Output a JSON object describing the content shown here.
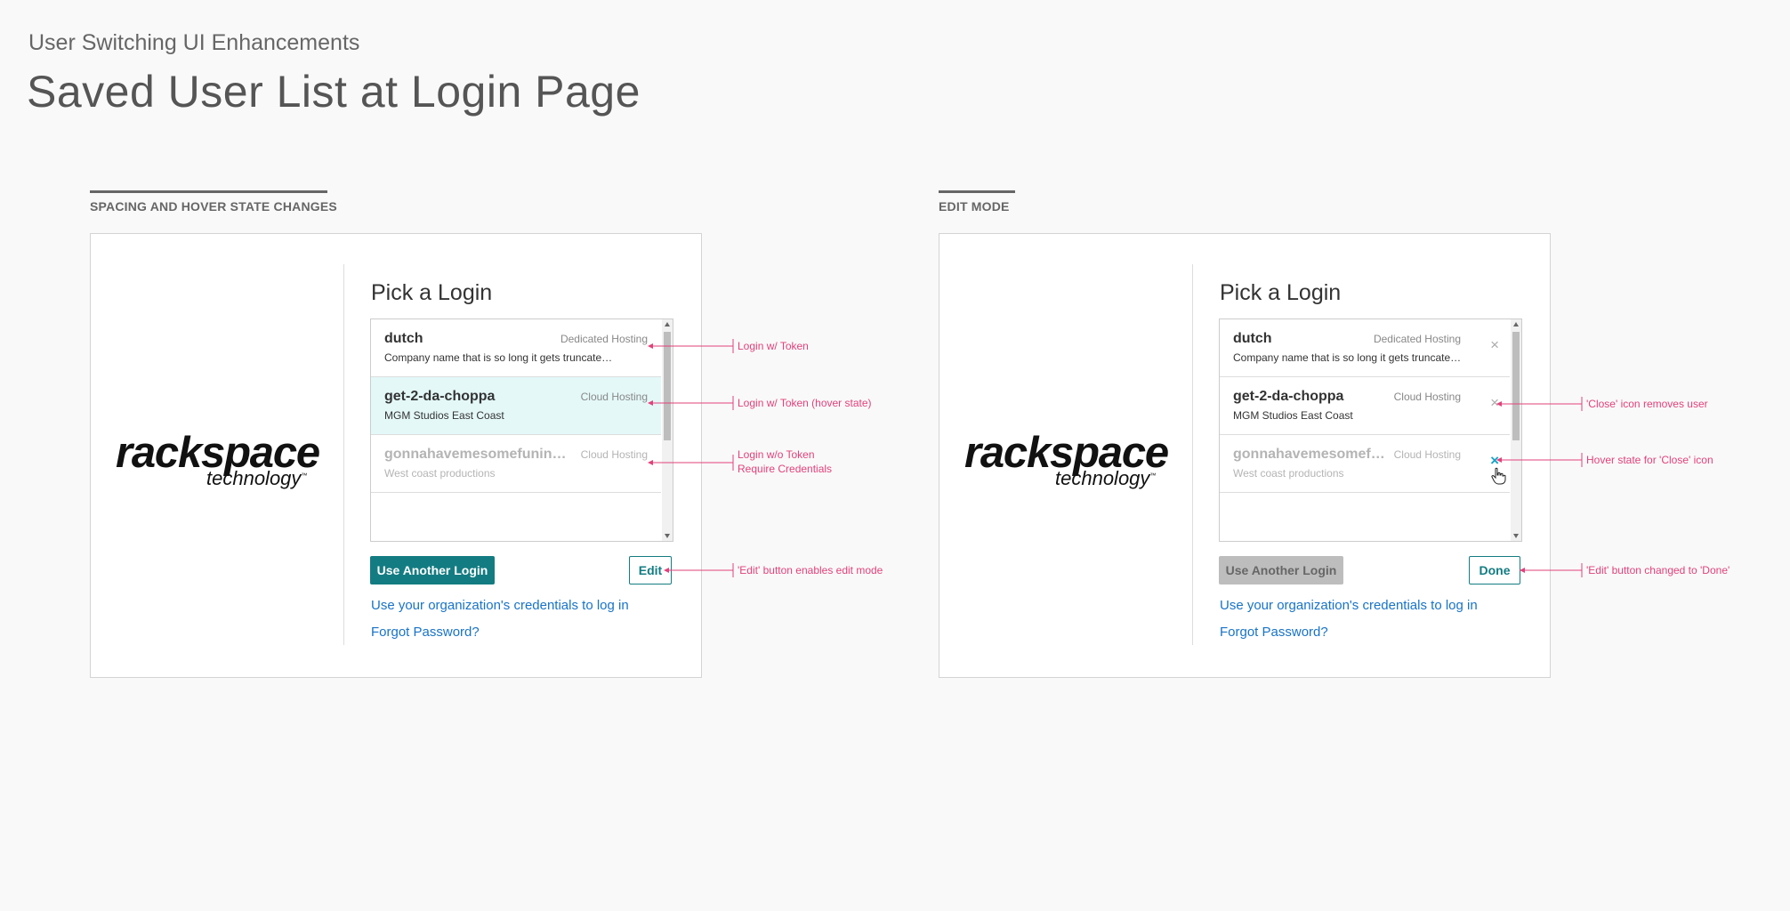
{
  "header": {
    "subtitle": "User Switching UI Enhancements",
    "title": "Saved User List at Login Page"
  },
  "panels": [
    {
      "section_label": "SPACING AND HOVER STATE CHANGES",
      "logo": {
        "line1": "rackspace",
        "line2": "technology",
        "mark": "™"
      },
      "heading": "Pick a Login",
      "logins": [
        {
          "username": "dutch",
          "service": "Dedicated Hosting",
          "org": "Company name that is so long it gets truncate…"
        },
        {
          "username": "get-2-da-choppa",
          "service": "Cloud Hosting",
          "org": "MGM Studios East Coast"
        },
        {
          "username": "gonnahavemesomefunin…",
          "service": "Cloud Hosting",
          "org": "West coast productions"
        }
      ],
      "primary_button": "Use Another Login",
      "secondary_button": "Edit",
      "link_sso": "Use your organization's credentials to log in",
      "link_forgot": "Forgot Password?",
      "annotations": [
        "Login w/ Token",
        "Login w/ Token (hover state)",
        "Login w/o Token",
        "Require Credentials",
        "'Edit' button enables edit mode"
      ]
    },
    {
      "section_label": "EDIT MODE",
      "logo": {
        "line1": "rackspace",
        "line2": "technology",
        "mark": "™"
      },
      "heading": "Pick a Login",
      "logins": [
        {
          "username": "dutch",
          "service": "Dedicated Hosting",
          "org": "Company name that is so long it gets truncate…"
        },
        {
          "username": "get-2-da-choppa",
          "service": "Cloud Hosting",
          "org": "MGM Studios East Coast"
        },
        {
          "username": "gonnahavemesomef…",
          "service": "Cloud Hosting",
          "org": "West coast productions"
        }
      ],
      "close_glyph": "×",
      "primary_button": "Use Another Login",
      "secondary_button": "Done",
      "link_sso": "Use your organization's credentials to log in",
      "link_forgot": "Forgot Password?",
      "annotations": [
        "'Close' icon removes user",
        "Hover state for 'Close' icon",
        "'Edit' button changed to 'Done'"
      ]
    }
  ],
  "colors": {
    "teal": "#137c82",
    "hover_row": "#e4f8f8",
    "link": "#1873c8",
    "annotation": "#e2417a",
    "close_hover": "#17a2c8"
  }
}
